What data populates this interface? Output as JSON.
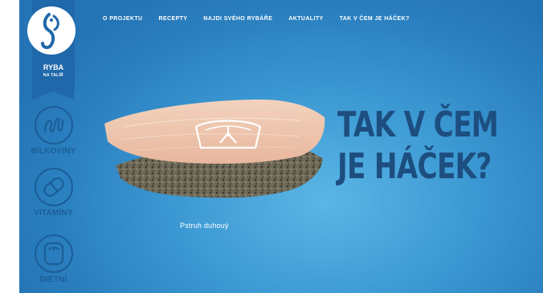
{
  "nav": [
    "O PROJEKTU",
    "RECEPTY",
    "NAJDI SVÉHO RYBÁŘE",
    "AKTUALITY",
    "TAK V ČEM JE HÁČEK?"
  ],
  "logo": {
    "title": "RYBA",
    "subtitle": "NA TALÍŘ"
  },
  "sidebar": [
    {
      "label": "BÍLKOVINY",
      "icon": "protein-icon"
    },
    {
      "label": "VITAMÍNY",
      "icon": "pill-icon"
    },
    {
      "label": "DIETNÍ",
      "icon": "scale-icon"
    }
  ],
  "headline": {
    "line1": "TAK V ČEM",
    "line2": "JE HÁČEK?"
  },
  "caption": "Pstruh duhouý",
  "colors": {
    "background": "#3b98d2",
    "headline": "#1d4e80",
    "ribbon": "#1f68aa"
  }
}
